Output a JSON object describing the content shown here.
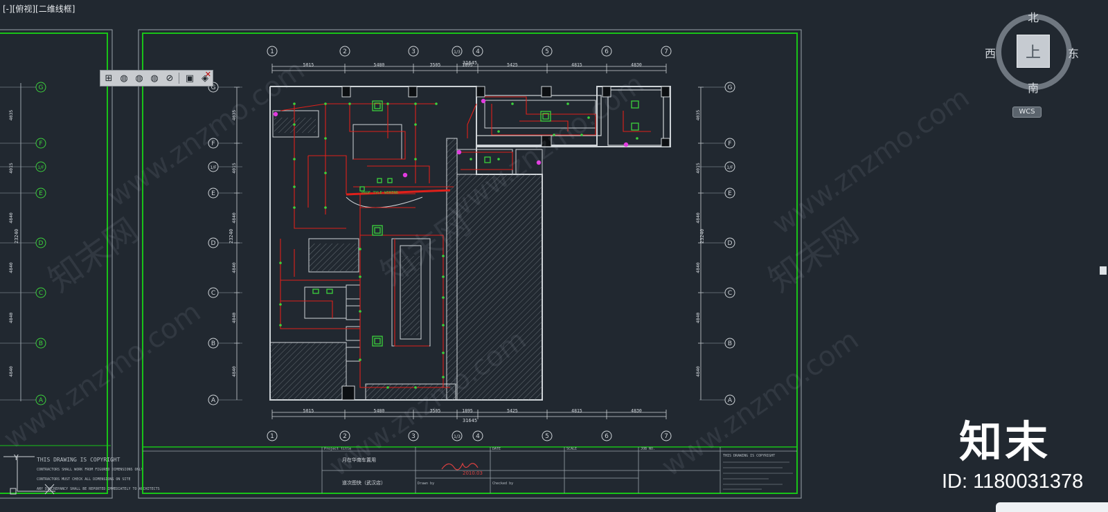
{
  "viewport": {
    "label": "[-][俯视][二维线框]"
  },
  "drawing": {
    "total_dim": "31645",
    "dims_top": [
      "5015",
      "5480",
      "3505",
      "1895",
      "5425",
      "4815",
      "4830"
    ],
    "dims_bottom": [
      "5015",
      "5480",
      "3505",
      "1895",
      "5425",
      "4815",
      "4830"
    ],
    "grid_cols": [
      "1",
      "2",
      "3",
      "1/3",
      "4",
      "5",
      "6",
      "7"
    ],
    "grid_rows": [
      "G",
      "F",
      "1/F",
      "E",
      "D",
      "C",
      "B",
      "A"
    ],
    "side_dims": [
      "4035",
      "4015",
      "4840",
      "4840",
      "4840",
      "4840"
    ],
    "side_total": "23240",
    "annotation": "PROF TYLE WIRING",
    "left_panel": {
      "notes": [
        "THIS DRAWING IS COPYRIGHT",
        "CONTRACTORS SHALL WORK FROM FIGURED DIMENSIONS ONLY",
        "CONTRACTORS MUST CHECK ALL DIMENSIONS ON SITE",
        "ANY DISCREPANCY SHALL BE REPORTED IMMEDIATELY TO ARCHITECTS"
      ]
    },
    "title_block": {
      "project_label": "Project title",
      "project_name": "月在华南车置用",
      "drawing_name": "道次图快（武汉店）",
      "drawn_label": "Drawn by",
      "check_label": "Checked by",
      "date_label": "DATE",
      "scale_label": "SCALE",
      "job_label": "JOB NO.",
      "signature_date": "2010.03",
      "copyright": "THIS DRAWING IS COPYRIGHT"
    }
  },
  "viewcube": {
    "north": "北",
    "south": "南",
    "east": "东",
    "west": "西",
    "top_face": "上",
    "wcs": "WCS"
  },
  "watermark": {
    "site": "www.znzmo.com",
    "cn": "知末网"
  },
  "brand": {
    "logo_text": "知末",
    "id_text": "ID: 1180031378"
  },
  "colors": {
    "background": "#212830",
    "frame": "#18c318",
    "wire": "#e0201a",
    "fixture": "#3cd23c",
    "marker": "#e23be0"
  }
}
